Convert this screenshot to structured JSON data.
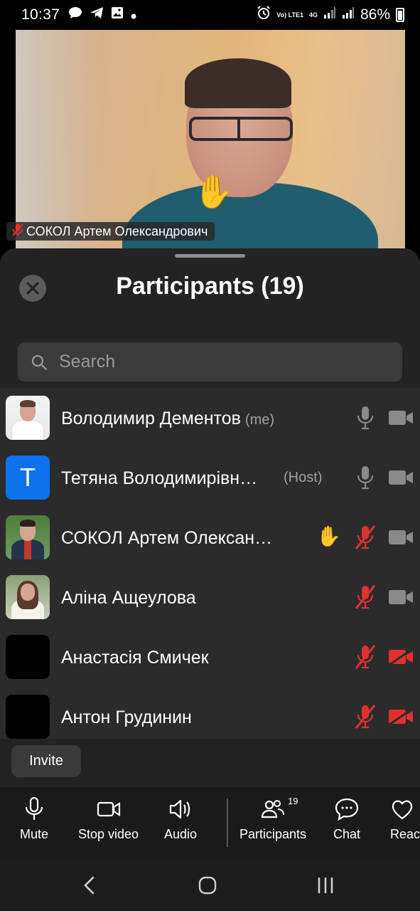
{
  "status_bar": {
    "time": "10:37",
    "left_icons": [
      "chat-bubble-icon",
      "telegram-icon",
      "image-icon",
      "dot-icon"
    ],
    "right_icons": [
      "alarm-icon",
      "volte-icon",
      "4g-icon",
      "signal-icon",
      "signal-icon"
    ],
    "volte_label": "Vo) LTE1",
    "network_label": "4G",
    "battery": "86%"
  },
  "video": {
    "speaker_name": "СОКОЛ Артем Олександрович",
    "speaker_muted": true,
    "raised_hand": "✋"
  },
  "sheet": {
    "title": "Participants (19)",
    "search_placeholder": "Search",
    "participants": [
      {
        "name": "Володимир Дементов",
        "tag": "(me)",
        "avatar": "photo",
        "hand": false,
        "mic": "on",
        "video": "on"
      },
      {
        "name": "Тетяна Володимирівн…",
        "tag": "(Host)",
        "avatar": "T",
        "hand": false,
        "mic": "on",
        "video": "on"
      },
      {
        "name": "СОКОЛ Артем Олексан…",
        "tag": "",
        "avatar": "photo",
        "hand": true,
        "mic": "muted",
        "video": "on"
      },
      {
        "name": "Аліна Ащеулова",
        "tag": "",
        "avatar": "photo",
        "hand": false,
        "mic": "muted",
        "video": "on"
      },
      {
        "name": "Анастасія Смичек",
        "tag": "",
        "avatar": "black",
        "hand": false,
        "mic": "muted",
        "video": "off"
      },
      {
        "name": "Антон Грудинин",
        "tag": "",
        "avatar": "black",
        "hand": false,
        "mic": "muted",
        "video": "off"
      }
    ],
    "invite_label": "Invite"
  },
  "toolbar": {
    "mute": "Mute",
    "stop_video": "Stop video",
    "audio": "Audio",
    "participants": "Participants",
    "participants_count": "19",
    "chat": "Chat",
    "reactions": "Reac"
  },
  "colors": {
    "accent_blue": "#0e72ed",
    "muted_red": "#e0312f",
    "sheet_bg": "#232323",
    "list_bg": "#2b2b2b"
  }
}
